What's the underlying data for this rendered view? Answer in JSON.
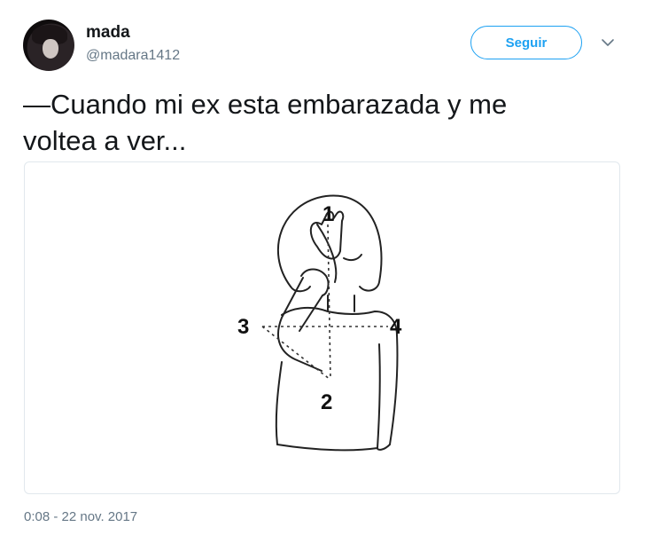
{
  "user": {
    "name": "mada",
    "handle": "@madara1412",
    "avatar_icon": "user-avatar-icon"
  },
  "follow_button": {
    "label": "Seguir"
  },
  "menu": {
    "icon": "chevron-down-icon"
  },
  "tweet": {
    "text": "—Cuando mi ex esta embarazada y me\nvoltea a ver...",
    "timestamp": "0:08 - 22 nov. 2017"
  },
  "image": {
    "labels": [
      "1",
      "2",
      "3",
      "4"
    ]
  },
  "colors": {
    "accent": "#1da1f2",
    "text": "#14171a",
    "secondary": "#657786",
    "border": "#e1e8ed"
  }
}
